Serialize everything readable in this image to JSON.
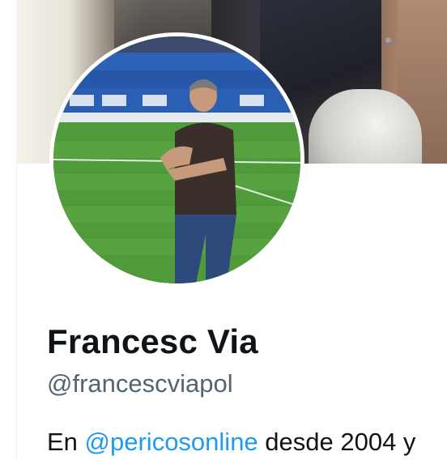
{
  "profile": {
    "name": "Francesc Via",
    "handle": "@francescviapol",
    "bio": {
      "prefix": "En ",
      "mention": "@pericosonline",
      "suffix": " desde 2004 y"
    },
    "banner_image": "banner-photo",
    "avatar_image": "profile-photo"
  },
  "colors": {
    "name": "#0f1419",
    "handle": "#536471",
    "link": "#1d9bf0",
    "border": "#eff3f4"
  }
}
